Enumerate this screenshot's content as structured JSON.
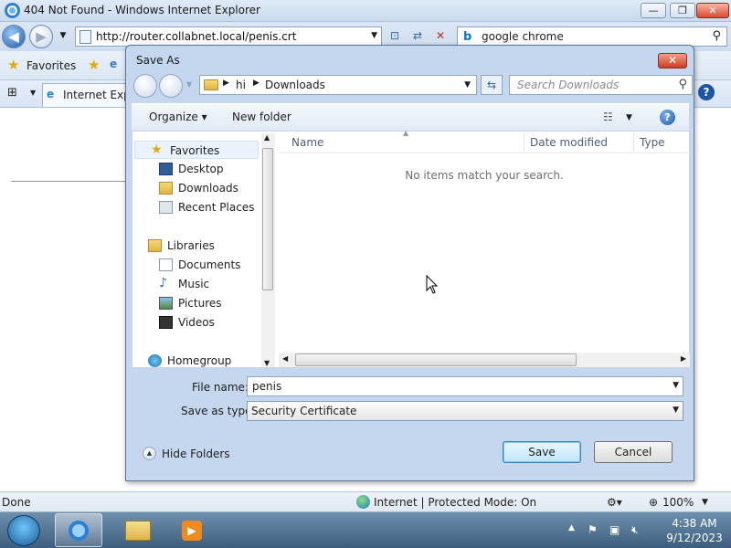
{
  "ie": {
    "title": "404 Not Found - Windows Internet Explorer",
    "address": "http://router.collabnet.local/penis.crt",
    "search_value": "google chrome",
    "favorites_label": "Favorites",
    "tab_label": "Internet Explorer",
    "status_left": "Done",
    "status_zone": "Internet | Protected Mode: On",
    "zoom": "100%"
  },
  "dialog": {
    "title": "Save As",
    "close_glyph": "✕",
    "breadcrumb": [
      "hi",
      "Downloads"
    ],
    "search_placeholder": "Search Downloads",
    "toolbar": {
      "organize": "Organize ▾",
      "new_folder": "New folder"
    },
    "nav_items": {
      "favorites": "Favorites",
      "desktop": "Desktop",
      "downloads": "Downloads",
      "recent_places": "Recent Places",
      "libraries": "Libraries",
      "documents": "Documents",
      "music": "Music",
      "pictures": "Pictures",
      "videos": "Videos",
      "homegroup": "Homegroup"
    },
    "columns": {
      "name": "Name",
      "date_modified": "Date modified",
      "type": "Type"
    },
    "empty_message": "No items match your search.",
    "file_name_label": "File name:",
    "file_name_value": "penis",
    "save_type_label": "Save as type:",
    "save_type_value": "Security Certificate",
    "hide_folders": "Hide Folders",
    "save_button": "Save",
    "cancel_button": "Cancel"
  },
  "taskbar": {
    "time": "4:38 AM",
    "date": "9/12/2023"
  }
}
